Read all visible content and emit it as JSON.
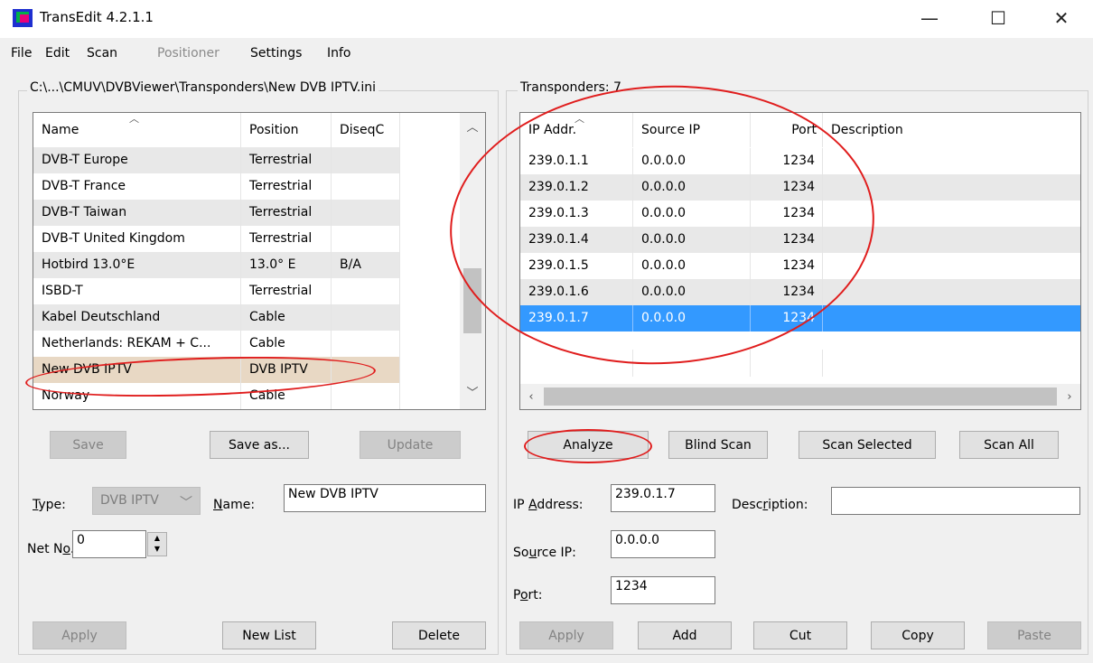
{
  "window": {
    "title": "TransEdit 4.2.1.1",
    "controls": {
      "minimize": "—",
      "maximize": "☐",
      "close": "✕"
    }
  },
  "menu": {
    "file": "File",
    "edit": "Edit",
    "scan": "Scan",
    "positioner": "Positioner",
    "settings": "Settings",
    "info": "Info"
  },
  "left_panel": {
    "group_title": "C:\\...\\CMUV\\DVBViewer\\Transponders\\New DVB IPTV.ini",
    "columns": [
      "Name",
      "Position",
      "DiseqC"
    ],
    "rows": [
      {
        "name": "DVB-T Europe",
        "position": "Terrestrial",
        "diseqc": ""
      },
      {
        "name": "DVB-T France",
        "position": "Terrestrial",
        "diseqc": ""
      },
      {
        "name": "DVB-T Taiwan",
        "position": "Terrestrial",
        "diseqc": ""
      },
      {
        "name": "DVB-T United Kingdom",
        "position": "Terrestrial",
        "diseqc": ""
      },
      {
        "name": "Hotbird 13.0°E",
        "position": "13.0° E",
        "diseqc": "B/A"
      },
      {
        "name": "ISBD-T",
        "position": "Terrestrial",
        "diseqc": ""
      },
      {
        "name": "Kabel Deutschland",
        "position": "Cable",
        "diseqc": ""
      },
      {
        "name": "Netherlands: REKAM + C...",
        "position": "Cable",
        "diseqc": ""
      },
      {
        "name": "New DVB IPTV",
        "position": "DVB IPTV",
        "diseqc": ""
      },
      {
        "name": "Norway",
        "position": "Cable",
        "diseqc": ""
      }
    ],
    "buttons": {
      "save": "Save",
      "save_as": "Save as...",
      "update": "Update"
    },
    "type_label": "Type:",
    "type_value": "DVB IPTV",
    "name_label": "Name:",
    "name_value": "New DVB IPTV",
    "netno_label": "Net No.",
    "netno_value": "0",
    "bottom_buttons": {
      "apply": "Apply",
      "new_list": "New List",
      "delete": "Delete"
    }
  },
  "right_panel": {
    "group_title": "Transponders: 7",
    "columns": [
      "IP Addr.",
      "Source IP",
      "Port",
      "Description"
    ],
    "rows": [
      {
        "ip": "239.0.1.1",
        "source": "0.0.0.0",
        "port": "1234",
        "desc": ""
      },
      {
        "ip": "239.0.1.2",
        "source": "0.0.0.0",
        "port": "1234",
        "desc": ""
      },
      {
        "ip": "239.0.1.3",
        "source": "0.0.0.0",
        "port": "1234",
        "desc": ""
      },
      {
        "ip": "239.0.1.4",
        "source": "0.0.0.0",
        "port": "1234",
        "desc": ""
      },
      {
        "ip": "239.0.1.5",
        "source": "0.0.0.0",
        "port": "1234",
        "desc": ""
      },
      {
        "ip": "239.0.1.6",
        "source": "0.0.0.0",
        "port": "1234",
        "desc": ""
      },
      {
        "ip": "239.0.1.7",
        "source": "0.0.0.0",
        "port": "1234",
        "desc": ""
      }
    ],
    "selected_row": "239.0.1.7",
    "scan_buttons": {
      "analyze": "Analyze",
      "blind_scan": "Blind Scan",
      "scan_selected": "Scan Selected",
      "scan_all": "Scan All"
    },
    "ip_label": "IP Address:",
    "ip_value": "239.0.1.7",
    "desc_label": "Description:",
    "desc_value": "",
    "source_label": "Source IP:",
    "source_value": "0.0.0.0",
    "port_label": "Port:",
    "port_value": "1234",
    "bottom_buttons": {
      "apply": "Apply",
      "add": "Add",
      "cut": "Cut",
      "copy": "Copy",
      "paste": "Paste"
    }
  },
  "colors": {
    "selection_blue": "#3399ff",
    "selection_beige": "#e8d8c4",
    "annotation_red": "#e01d1d"
  },
  "icons": {
    "app": "transedit-app-icon",
    "sort": "sort-up-arrow",
    "spin": "spin-buttons"
  }
}
